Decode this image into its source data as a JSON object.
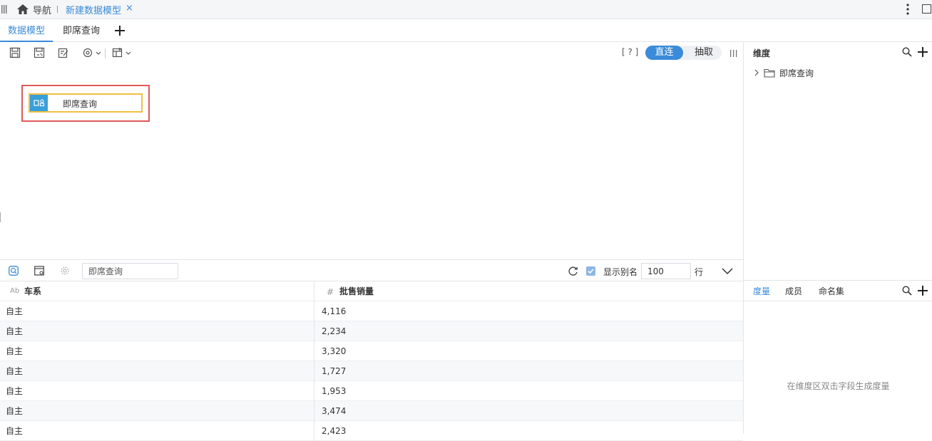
{
  "topbar": {
    "nav_label": "导航",
    "active_tab": "新建数据模型",
    "close_glyph": "×"
  },
  "tabs": [
    {
      "label": "数据模型",
      "active": true
    },
    {
      "label": "即席查询",
      "active": false
    }
  ],
  "toolbar": {
    "help": "[ ? ]",
    "connection_modes": [
      "直连",
      "抽取"
    ],
    "active_mode": "直连"
  },
  "canvas": {
    "table_node": {
      "label": "即席查询"
    }
  },
  "dimension_panel": {
    "title": "维度",
    "tree": [
      {
        "label": "即席查询",
        "icon": "folder-icon"
      }
    ]
  },
  "measure_panel": {
    "tabs": [
      "度量",
      "成员",
      "命名集"
    ],
    "active_tab": "度量",
    "empty_hint": "在维度区双击字段生成度量"
  },
  "preview": {
    "source_name": "即席查询",
    "show_alias_label": "显示别名",
    "show_alias_checked": true,
    "row_limit": "100",
    "row_unit": "行"
  },
  "table": {
    "columns": [
      {
        "label": "车系",
        "type_icon": "Ab"
      },
      {
        "label": "批售销量",
        "type_icon": "#"
      }
    ],
    "rows": [
      [
        "自主",
        "4,116"
      ],
      [
        "自主",
        "2,234"
      ],
      [
        "自主",
        "3,320"
      ],
      [
        "自主",
        "1,727"
      ],
      [
        "自主",
        "1,953"
      ],
      [
        "自主",
        "3,474"
      ],
      [
        "自主",
        "2,423"
      ]
    ]
  },
  "colors": {
    "accent": "#3a8bd8",
    "node_icon": "#3a9fd8",
    "node_border": "#f0c040",
    "highlight": "#e05a5a"
  }
}
